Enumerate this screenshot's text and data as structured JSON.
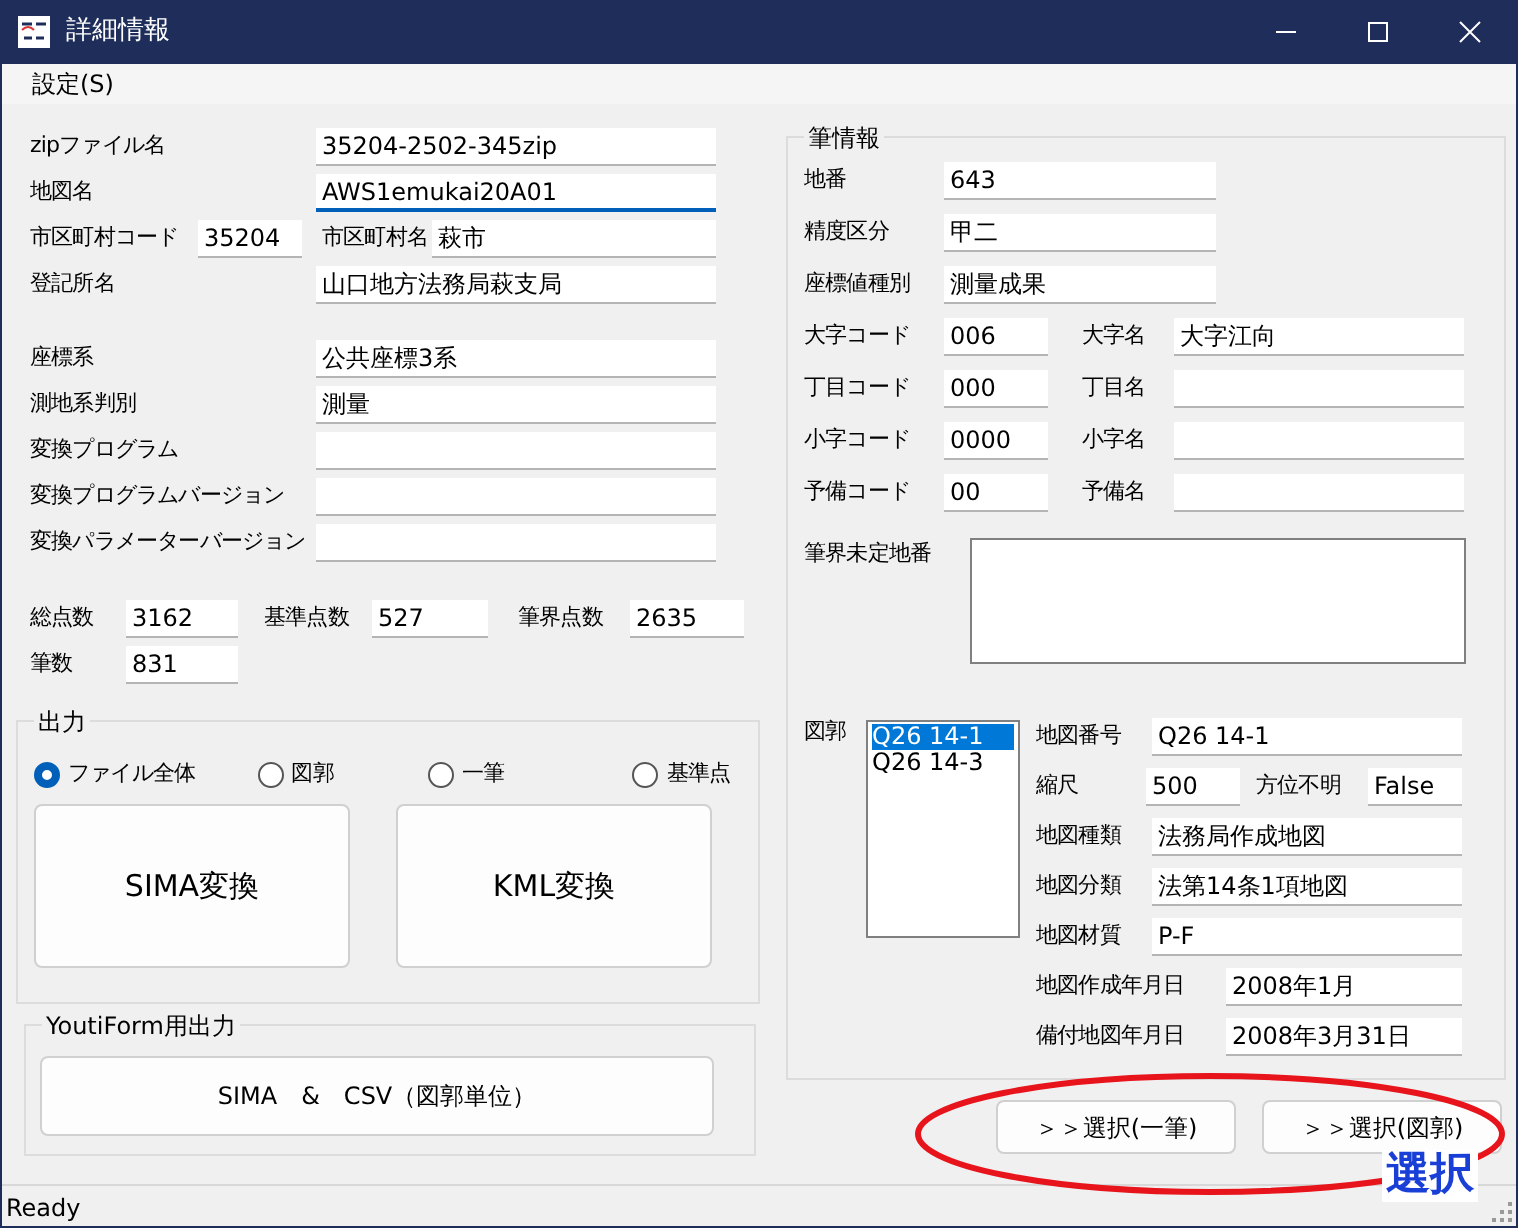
{
  "window": {
    "title": "詳細情報"
  },
  "menu": [
    {
      "label": "設定(S)"
    }
  ],
  "file_info": [
    {
      "kind": "wide",
      "label": "zipファイル名",
      "value": "35204-2502-345zip",
      "focused": false
    },
    {
      "kind": "wide",
      "label": "地図名",
      "value": "AWS1emukai20A01",
      "focused": true
    },
    {
      "kind": "pair",
      "label": "市区町村コード",
      "value": "35204",
      "label2": "市区町村名",
      "value2": "萩市"
    },
    {
      "kind": "wide",
      "label": "登記所名",
      "value": "山口地方法務局萩支局",
      "focused": false
    }
  ],
  "system_info": [
    {
      "label": "座標系",
      "value": "公共座標3系"
    },
    {
      "label": "測地系判別",
      "value": "測量"
    },
    {
      "label": "変換プログラム"
    },
    {
      "label": "変換プログラムバージョン"
    },
    {
      "label": "変換パラメーターバージョン"
    }
  ],
  "counts": [
    {
      "label": "総点数",
      "value": "3162"
    },
    {
      "label": "基準点数",
      "value": "527"
    },
    {
      "label": "筆界点数",
      "value": "2635"
    },
    {
      "label": "筆数",
      "value": "831"
    }
  ],
  "output": {
    "title": "出力",
    "options": [
      {
        "label": "ファイル全体",
        "selected": true
      },
      {
        "label": "図郭",
        "selected": false
      },
      {
        "label": "一筆",
        "selected": false
      },
      {
        "label": "基準点",
        "selected": false
      }
    ],
    "buttons": [
      "SIMA変換",
      "KML変換"
    ]
  },
  "youtiform": {
    "title": "YoutiForm用出力",
    "button": "SIMA　&　CSV（図郭単位）"
  },
  "parcel": {
    "title": "筆情報",
    "fields": [
      {
        "label": "地番",
        "value": "643"
      },
      {
        "label": "精度区分",
        "value": "甲二"
      },
      {
        "label": "座標値種別",
        "value": "測量成果"
      }
    ],
    "codes": [
      {
        "code_label": "大字コード",
        "code": "006",
        "name_label": "大字名",
        "name": "大字江向"
      },
      {
        "code_label": "丁目コード",
        "code": "000",
        "name_label": "丁目名"
      },
      {
        "code_label": "小字コード",
        "code": "0000",
        "name_label": "小字名"
      },
      {
        "code_label": "予備コード",
        "code": "00",
        "name_label": "予備名"
      }
    ],
    "undetermined_label": "筆界未定地番",
    "zukaku": {
      "label": "図郭",
      "items": [
        {
          "text": "Q26 14-1",
          "selected": true
        },
        {
          "text": "Q26 14-3",
          "selected": false
        }
      ],
      "details": [
        {
          "kind": "wide",
          "label": "地図番号",
          "value": "Q26 14-1"
        },
        {
          "kind": "pair",
          "label": "縮尺",
          "value": "500",
          "label2": "方位不明",
          "value2": "False"
        },
        {
          "kind": "wide",
          "label": "地図種類",
          "value": "法務局作成地図"
        },
        {
          "kind": "wide",
          "label": "地図分類",
          "value": "法第14条1項地図"
        },
        {
          "kind": "wide",
          "label": "地図材質",
          "value": "P-F"
        },
        {
          "kind": "date",
          "label": "地図作成年月日",
          "value": "2008年1月"
        },
        {
          "kind": "date",
          "label": "備付地図年月日",
          "value": "2008年3月31日"
        }
      ]
    }
  },
  "select_buttons": [
    "＞＞選択(一筆)",
    "＞＞選択(図郭)"
  ],
  "annotation": {
    "text": "選択"
  },
  "status_bar": "Ready"
}
